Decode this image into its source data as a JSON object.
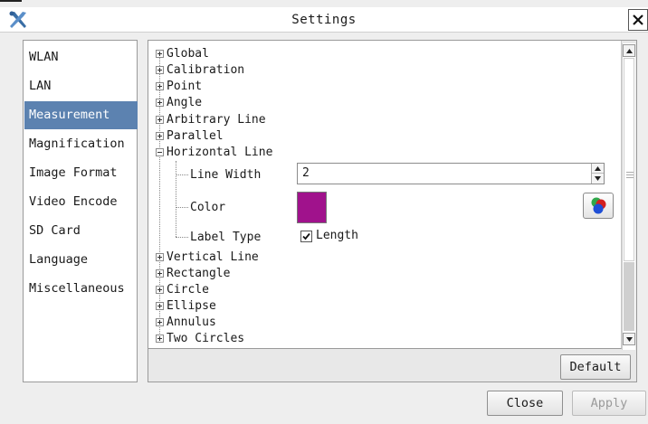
{
  "window": {
    "title": "Settings",
    "app_icon": "tools-cross-icon",
    "close_icon": "close-icon"
  },
  "sidebar": {
    "items": [
      {
        "label": "WLAN",
        "active": false
      },
      {
        "label": "LAN",
        "active": false
      },
      {
        "label": "Measurement",
        "active": true
      },
      {
        "label": "Magnification",
        "active": false
      },
      {
        "label": "Image Format",
        "active": false
      },
      {
        "label": "Video Encode",
        "active": false
      },
      {
        "label": "SD Card",
        "active": false
      },
      {
        "label": "Language",
        "active": false
      },
      {
        "label": "Miscellaneous",
        "active": false
      }
    ]
  },
  "tree": {
    "top_items": [
      {
        "label": "Global",
        "expanded": false
      },
      {
        "label": "Calibration",
        "expanded": false
      },
      {
        "label": "Point",
        "expanded": false
      },
      {
        "label": "Angle",
        "expanded": false
      },
      {
        "label": "Arbitrary Line",
        "expanded": false
      },
      {
        "label": "Parallel",
        "expanded": false
      },
      {
        "label": "Horizontal Line",
        "expanded": true
      }
    ],
    "horizontal_line": {
      "line_width_label": "Line Width",
      "line_width_value": "2",
      "color_label": "Color",
      "color_value": "#a0128c",
      "label_type_label": "Label Type",
      "length_label": "Length",
      "length_checked": true
    },
    "bottom_items": [
      {
        "label": "Vertical Line",
        "expanded": false
      },
      {
        "label": "Rectangle",
        "expanded": false
      },
      {
        "label": "Circle",
        "expanded": false
      },
      {
        "label": "Ellipse",
        "expanded": false
      },
      {
        "label": "Annulus",
        "expanded": false
      },
      {
        "label": "Two Circles",
        "expanded": false
      }
    ]
  },
  "buttons": {
    "default": "Default",
    "close": "Close",
    "apply": "Apply",
    "apply_enabled": false
  },
  "colors": {
    "selected_bg": "#5c82b0",
    "swatch": "#a0128c"
  }
}
